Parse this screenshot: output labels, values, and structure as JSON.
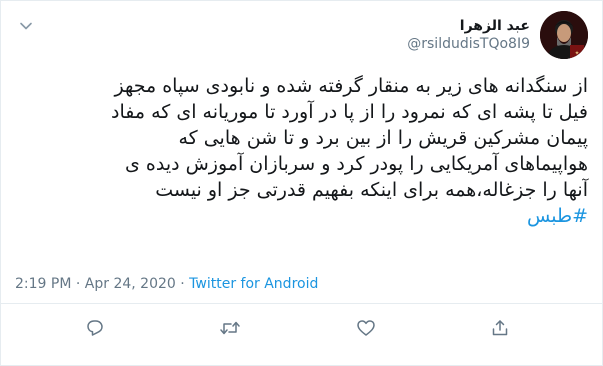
{
  "user": {
    "display_name": "عبد الزهرا",
    "handle": "@rsildudisTQo8I9"
  },
  "tweet": {
    "lines": [
      "از سنگدانه های زیر به منقار گرفته شده و نابودی سپاه مجهز",
      "فیل تا پشه ای که نمرود را از پا در آورد تا موریانه ای که مفاد",
      "پیمان مشرکین قریش را از بین برد و تا شن هایی که",
      "هواپیماهای آمریکایی را پودر کرد و سربازان آموزش دیده ی",
      "آنها را جزغاله،همه برای اینکه بفهیم قدرتی جز او نیست"
    ],
    "hashtag": "#طبس"
  },
  "meta": {
    "time": "2:19 PM",
    "separator": " · ",
    "date": "Apr 24, 2020",
    "source": "Twitter for Android"
  },
  "icons": {
    "menu": "chevron-down-icon",
    "reply": "reply-icon",
    "retweet": "retweet-icon",
    "like": "like-icon",
    "share": "share-icon"
  },
  "colors": {
    "link": "#1b95e0",
    "muted": "#657786",
    "text": "#14171a",
    "border": "#e6ecf0"
  }
}
